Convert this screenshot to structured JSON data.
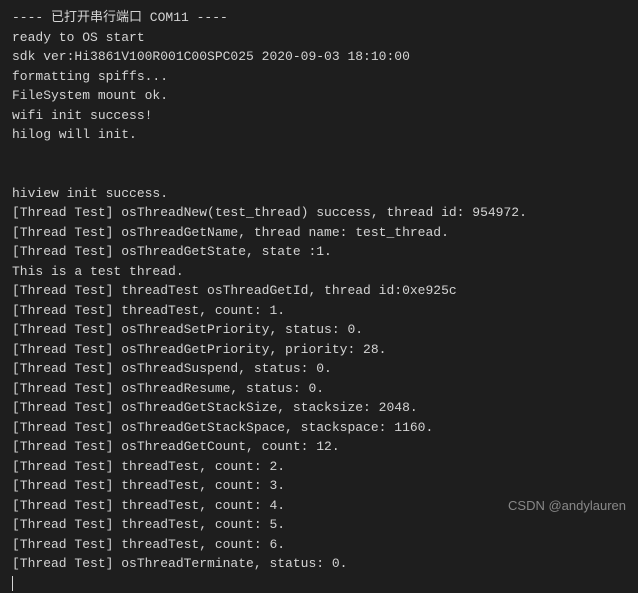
{
  "terminal": {
    "lines": [
      "---- 已打开串行端口 COM11 ----",
      "ready to OS start",
      "sdk ver:Hi3861V100R001C00SPC025 2020-09-03 18:10:00",
      "formatting spiffs...",
      "FileSystem mount ok.",
      "wifi init success!",
      "hilog will init.",
      "",
      "",
      "hiview init success.",
      "[Thread Test] osThreadNew(test_thread) success, thread id: 954972.",
      "[Thread Test] osThreadGetName, thread name: test_thread.",
      "[Thread Test] osThreadGetState, state :1.",
      "This is a test thread.",
      "[Thread Test] threadTest osThreadGetId, thread id:0xe925c",
      "[Thread Test] threadTest, count: 1.",
      "[Thread Test] osThreadSetPriority, status: 0.",
      "[Thread Test] osThreadGetPriority, priority: 28.",
      "[Thread Test] osThreadSuspend, status: 0.",
      "[Thread Test] osThreadResume, status: 0.",
      "[Thread Test] osThreadGetStackSize, stacksize: 2048.",
      "[Thread Test] osThreadGetStackSpace, stackspace: 1160.",
      "[Thread Test] osThreadGetCount, count: 12.",
      "[Thread Test] threadTest, count: 2.",
      "[Thread Test] threadTest, count: 3.",
      "[Thread Test] threadTest, count: 4.",
      "[Thread Test] threadTest, count: 5.",
      "[Thread Test] threadTest, count: 6.",
      "[Thread Test] osThreadTerminate, status: 0."
    ]
  },
  "watermark": "CSDN @andylauren"
}
